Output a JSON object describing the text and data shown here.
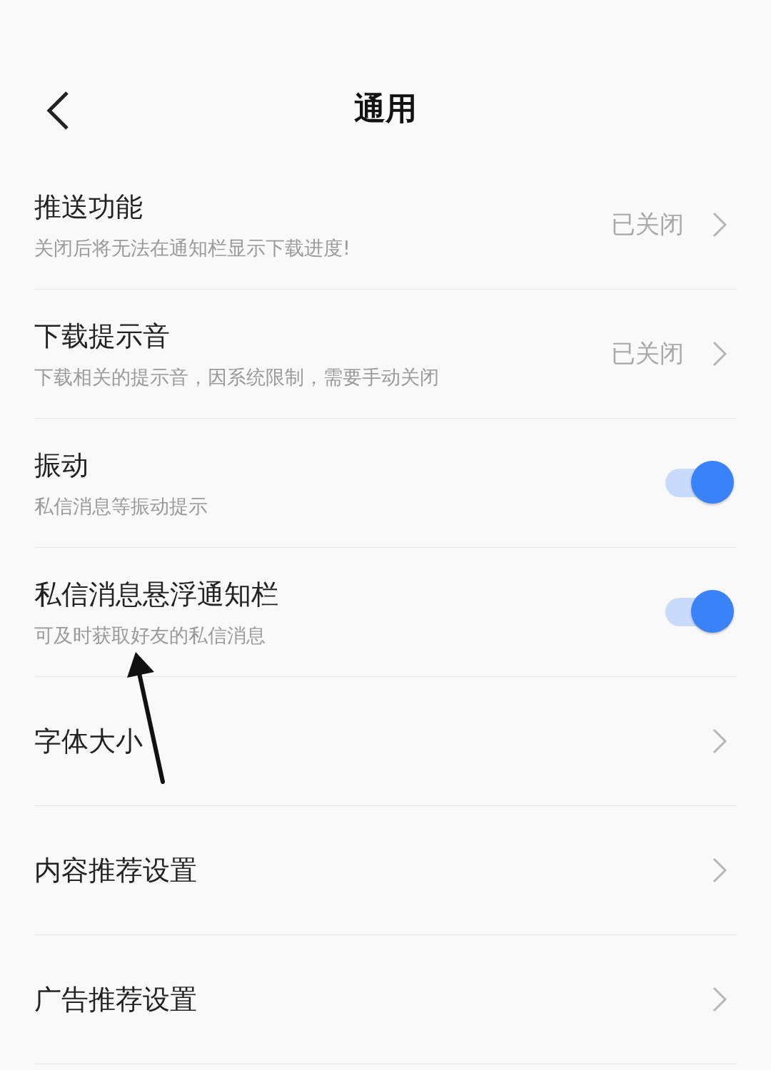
{
  "header": {
    "title": "通用"
  },
  "settings": [
    {
      "kind": "value",
      "title": "推送功能",
      "subtitle": "关闭后将无法在通知栏显示下载进度!",
      "value": "已关闭"
    },
    {
      "kind": "value",
      "title": "下载提示音",
      "subtitle": "下载相关的提示音，因系统限制，需要手动关闭",
      "value": "已关闭"
    },
    {
      "kind": "toggle",
      "title": "振动",
      "subtitle": "私信消息等振动提示",
      "on": true
    },
    {
      "kind": "toggle",
      "title": "私信消息悬浮通知栏",
      "subtitle": "可及时获取好友的私信消息",
      "on": true
    },
    {
      "kind": "link",
      "title": "字体大小"
    },
    {
      "kind": "link",
      "title": "内容推荐设置"
    },
    {
      "kind": "link",
      "title": "广告推荐设置"
    }
  ]
}
